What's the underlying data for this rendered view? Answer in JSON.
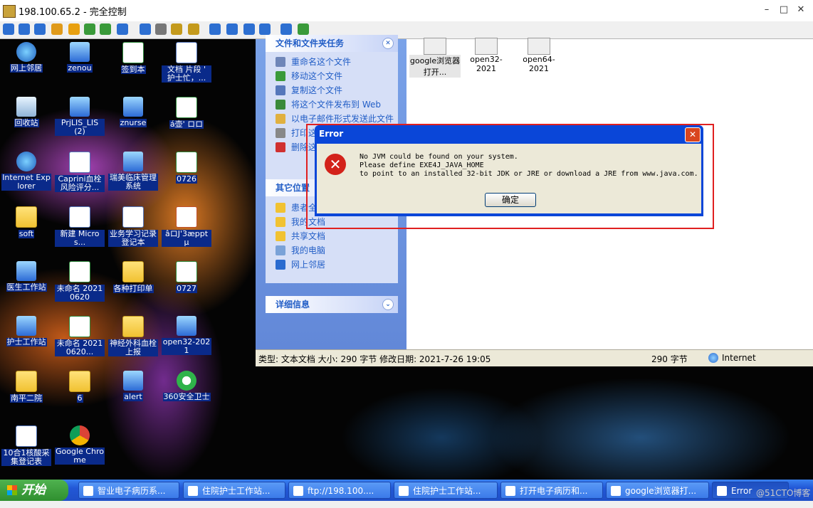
{
  "window": {
    "title": "198.100.65.2 - 完全控制"
  },
  "toolbar_icons": [
    "session-icon",
    "monitor-icon",
    "console-icon",
    "transfer-icon",
    "info-icon",
    "chat-icon",
    "call-icon",
    "message-icon",
    "upload-icon",
    "users-icon",
    "lock-icon",
    "lock2-icon",
    "fit-icon",
    "fullscreen-icon",
    "scale-icon",
    "zoom-icon",
    "screenshot-icon",
    "settings-icon"
  ],
  "desktop_icons": [
    {
      "label": "网上邻居",
      "type": "web"
    },
    {
      "label": "zenou",
      "type": "app"
    },
    {
      "label": "签到本",
      "type": "xls"
    },
    {
      "label": "文档 片段 ' 护士忙，...",
      "type": "doc"
    },
    {
      "label": "回收站",
      "type": "trash"
    },
    {
      "label": "PrjLIS_LIS (2)",
      "type": "app"
    },
    {
      "label": "znurse",
      "type": "app"
    },
    {
      "label": "á壶' ロロ",
      "type": "xls"
    },
    {
      "label": "Internet Explorer",
      "type": "web"
    },
    {
      "label": "Caprini血栓风险评分...",
      "type": "doc"
    },
    {
      "label": "瑞美临床管理系统",
      "type": "app"
    },
    {
      "label": "0726",
      "type": "xls"
    },
    {
      "label": "soft",
      "type": "folder"
    },
    {
      "label": "新建 Micros...",
      "type": "doc"
    },
    {
      "label": "业务学习记录登记本",
      "type": "doc"
    },
    {
      "label": "âロJ'3æppt µ",
      "type": "ppt"
    },
    {
      "label": "医生工作站",
      "type": "app"
    },
    {
      "label": "未命名 20210620",
      "type": "xls"
    },
    {
      "label": "各种打印单",
      "type": "folder"
    },
    {
      "label": "0727",
      "type": "xls"
    },
    {
      "label": "护士工作站",
      "type": "app"
    },
    {
      "label": "未命名 20210620...",
      "type": "xls"
    },
    {
      "label": "神经外科血栓上报",
      "type": "folder"
    },
    {
      "label": "open32-2021",
      "type": "app"
    },
    {
      "label": "南平二院",
      "type": "folder"
    },
    {
      "label": "6",
      "type": "folder"
    },
    {
      "label": "alert",
      "type": "app"
    },
    {
      "label": "360安全卫士",
      "type": "shield"
    },
    {
      "label": "10合1核酸采集登记表",
      "type": "doc"
    },
    {
      "label": "Google Chrome",
      "type": "chrome"
    }
  ],
  "explorer": {
    "file_tasks": {
      "header": "文件和文件夹任务",
      "items": [
        "重命名这个文件",
        "移动这个文件",
        "复制这个文件",
        "将这个文件发布到 Web",
        "以电子邮件形式发送此文件",
        "打印这",
        "删除这"
      ]
    },
    "other_places": {
      "header": "其它位置",
      "items": [
        "患者全病历资料",
        "我的文档",
        "共享文档",
        "我的电脑",
        "网上邻居"
      ]
    },
    "details": {
      "header": "详细信息"
    },
    "files": [
      {
        "label": "google浏览器打开..."
      },
      {
        "label": "open32-2021"
      },
      {
        "label": "open64-2021"
      }
    ],
    "status": {
      "left": "类型: 文本文档 大小: 290 字节 修改日期: 2021-7-26 19:05",
      "size": "290 字节",
      "zone": "Internet"
    }
  },
  "error_dialog": {
    "title": "Error",
    "lines": [
      "No JVM could be found on your system.",
      "Please define EXE4J_JAVA_HOME",
      "to point to an installed 32-bit JDK or JRE or download a JRE from www.java.com."
    ],
    "ok_label": "确定"
  },
  "taskbar": {
    "start_label": "开始",
    "buttons": [
      {
        "label": "智业电子病历系..."
      },
      {
        "label": "住院护士工作站..."
      },
      {
        "label": "ftp://198.100...."
      },
      {
        "label": "住院护士工作站..."
      },
      {
        "label": "打开电子病历和..."
      },
      {
        "label": "google浏览器打..."
      },
      {
        "label": "Error"
      }
    ]
  },
  "watermark": "@51CTO博客"
}
